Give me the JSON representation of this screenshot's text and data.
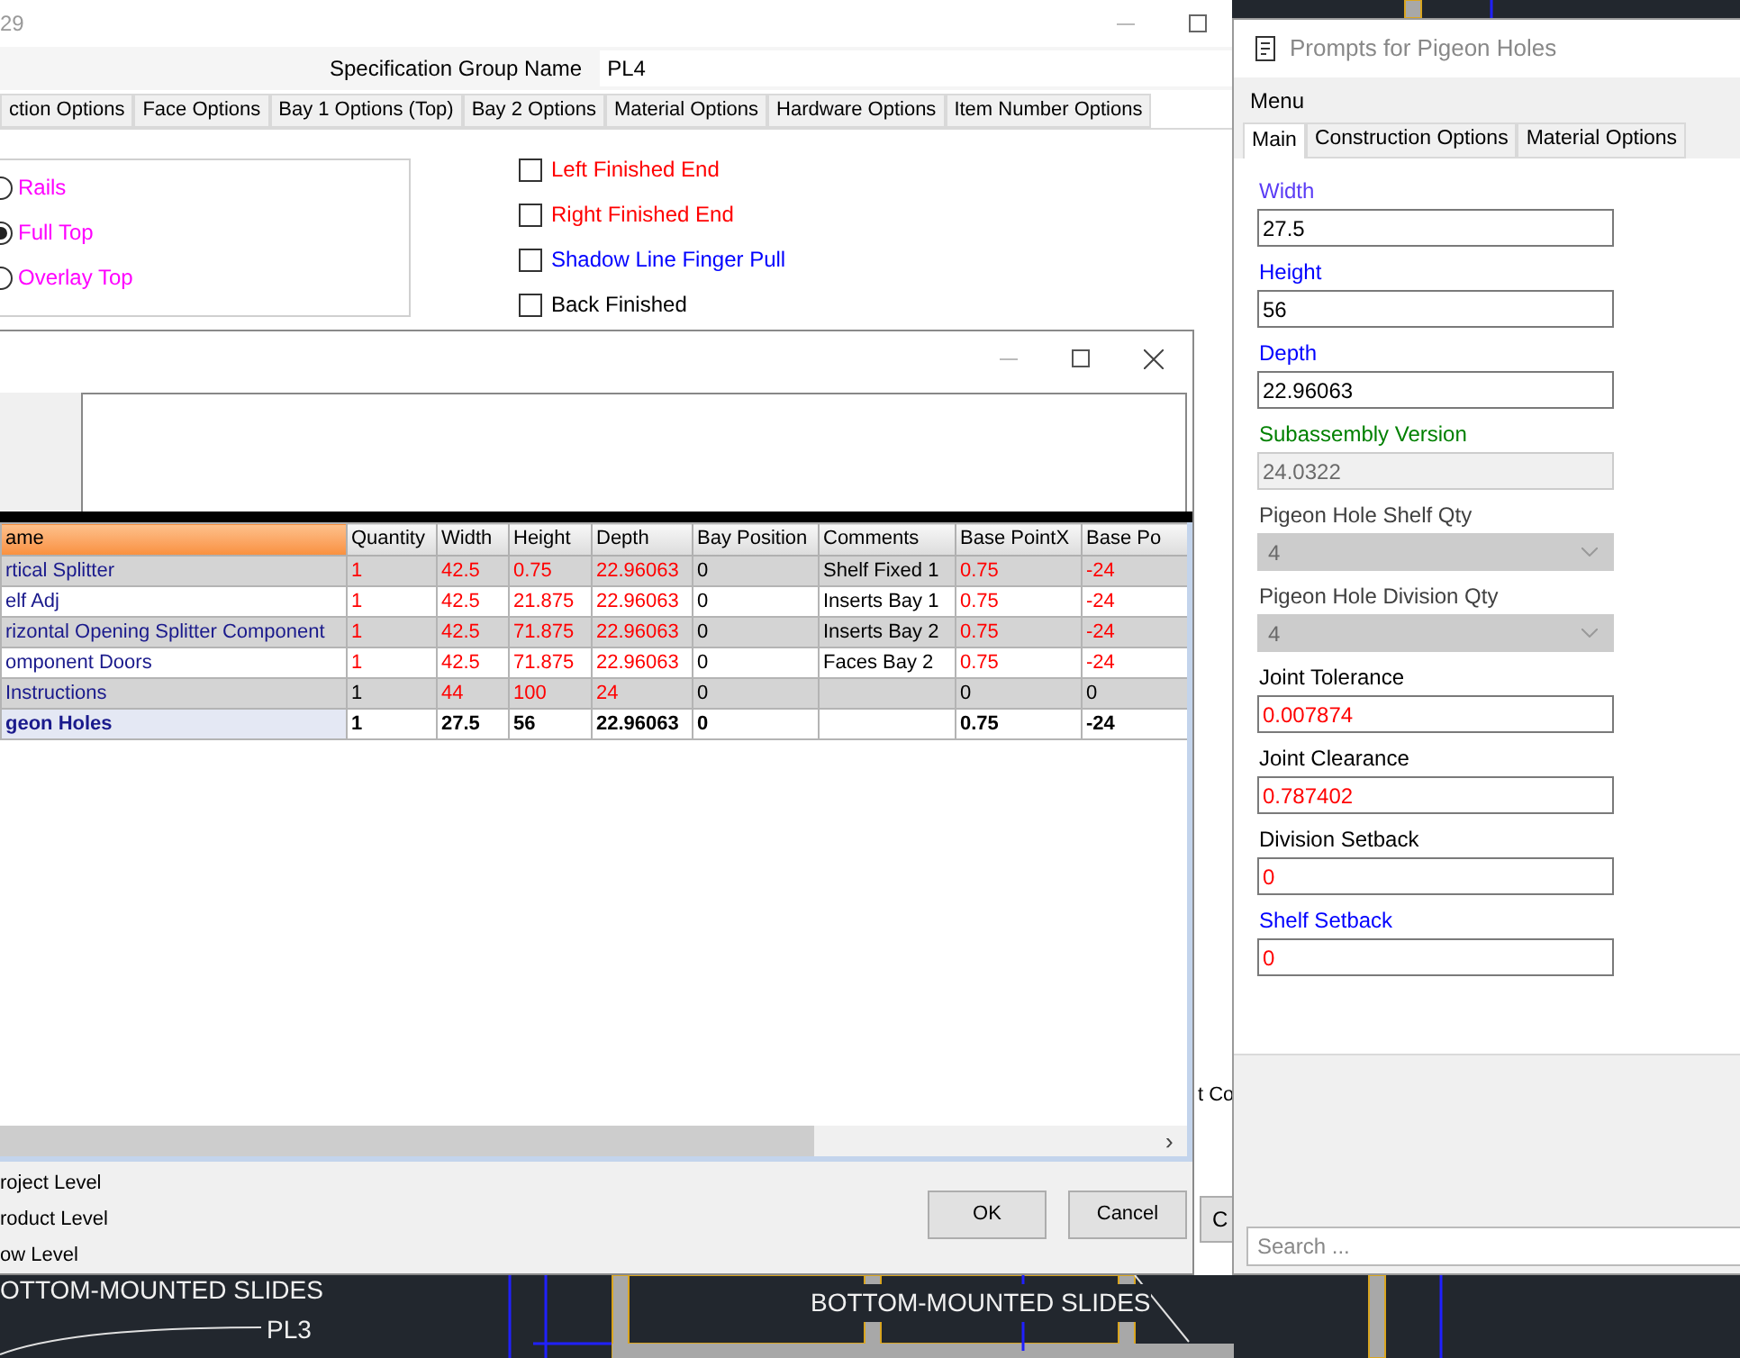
{
  "cad": {
    "labels": [
      "OTTOM-MOUNTED SLIDES",
      "PL3",
      "BOTTOM-MOUNTED SLIDES"
    ]
  },
  "main_window": {
    "title": "29",
    "spec_label": "Specification Group Name",
    "spec_value": "PL4",
    "tabs": [
      {
        "label": "ction Options",
        "selected": false
      },
      {
        "label": "Face Options",
        "selected": false
      },
      {
        "label": "Bay 1 Options (Top)",
        "selected": false
      },
      {
        "label": "Bay 2 Options",
        "selected": false
      },
      {
        "label": "Material Options",
        "selected": false
      },
      {
        "label": "Hardware Options",
        "selected": false
      },
      {
        "label": "Item Number Options",
        "selected": false
      }
    ],
    "radios": [
      {
        "label": "Rails",
        "selected": false
      },
      {
        "label": "Full Top",
        "selected": true
      },
      {
        "label": "Overlay Top",
        "selected": false
      }
    ],
    "checkboxes": [
      {
        "label": "Left Finished End",
        "checked": false,
        "color": "#ff0000"
      },
      {
        "label": "Right Finished End",
        "checked": false,
        "color": "#ff0000"
      },
      {
        "label": "Shadow Line Finger Pull",
        "checked": false,
        "color": "#0000ff"
      },
      {
        "label": "Back Finished",
        "checked": false,
        "color": "#000000"
      }
    ],
    "side_text": "t Co",
    "side_button": "C"
  },
  "dialog": {
    "columns": [
      {
        "label": "ame",
        "selected": true
      },
      {
        "label": "Quantity",
        "selected": false
      },
      {
        "label": "Width",
        "selected": false
      },
      {
        "label": "Height",
        "selected": false
      },
      {
        "label": "Depth",
        "selected": false
      },
      {
        "label": "Bay Position",
        "selected": false
      },
      {
        "label": "Comments",
        "selected": false
      },
      {
        "label": "Base PointX",
        "selected": false
      },
      {
        "label": "Base Po",
        "selected": false
      }
    ],
    "rows": [
      {
        "selected": false,
        "cells": [
          {
            "text": "rtical Splitter",
            "flagged": false
          },
          {
            "text": "1",
            "flagged": true
          },
          {
            "text": "42.5",
            "flagged": true
          },
          {
            "text": "0.75",
            "flagged": true
          },
          {
            "text": "22.96063",
            "flagged": true
          },
          {
            "text": "0",
            "flagged": false
          },
          {
            "text": "Shelf Fixed 1",
            "flagged": false
          },
          {
            "text": "0.75",
            "flagged": true
          },
          {
            "text": "-24",
            "flagged": true
          }
        ]
      },
      {
        "selected": false,
        "cells": [
          {
            "text": "elf Adj",
            "flagged": false
          },
          {
            "text": "1",
            "flagged": true
          },
          {
            "text": "42.5",
            "flagged": true
          },
          {
            "text": "21.875",
            "flagged": true
          },
          {
            "text": "22.96063",
            "flagged": true
          },
          {
            "text": "0",
            "flagged": false
          },
          {
            "text": "Inserts Bay 1",
            "flagged": false
          },
          {
            "text": "0.75",
            "flagged": true
          },
          {
            "text": "-24",
            "flagged": true
          }
        ]
      },
      {
        "selected": false,
        "cells": [
          {
            "text": "rizontal Opening Splitter Component",
            "flagged": false
          },
          {
            "text": "1",
            "flagged": true
          },
          {
            "text": "42.5",
            "flagged": true
          },
          {
            "text": "71.875",
            "flagged": true
          },
          {
            "text": "22.96063",
            "flagged": true
          },
          {
            "text": "0",
            "flagged": false
          },
          {
            "text": "Inserts Bay 2",
            "flagged": false
          },
          {
            "text": "0.75",
            "flagged": true
          },
          {
            "text": "-24",
            "flagged": true
          }
        ]
      },
      {
        "selected": false,
        "cells": [
          {
            "text": "omponent Doors",
            "flagged": false
          },
          {
            "text": "1",
            "flagged": true
          },
          {
            "text": "42.5",
            "flagged": true
          },
          {
            "text": "71.875",
            "flagged": true
          },
          {
            "text": "22.96063",
            "flagged": true
          },
          {
            "text": "0",
            "flagged": false
          },
          {
            "text": "Faces Bay 2",
            "flagged": false
          },
          {
            "text": "0.75",
            "flagged": true
          },
          {
            "text": "-24",
            "flagged": true
          }
        ]
      },
      {
        "selected": false,
        "cells": [
          {
            "text": "Instructions",
            "flagged": false
          },
          {
            "text": "1",
            "flagged": false
          },
          {
            "text": "44",
            "flagged": true
          },
          {
            "text": "100",
            "flagged": true
          },
          {
            "text": "24",
            "flagged": true
          },
          {
            "text": "0",
            "flagged": false
          },
          {},
          {
            "text": "0",
            "flagged": false
          },
          {
            "text": "0",
            "flagged": false
          }
        ]
      },
      {
        "selected": true,
        "cells": [
          {
            "text": "geon Holes",
            "flagged": false
          },
          {
            "text": "1",
            "flagged": false
          },
          {
            "text": "27.5",
            "flagged": false
          },
          {
            "text": "56",
            "flagged": false
          },
          {
            "text": "22.96063",
            "flagged": false
          },
          {
            "text": "0",
            "flagged": false
          },
          {},
          {
            "text": "0.75",
            "flagged": false
          },
          {
            "text": "-24",
            "flagged": false
          }
        ]
      }
    ],
    "levels": [
      "roject Level",
      "roduct Level",
      "ow Level"
    ],
    "buttons": [
      "OK",
      "Cancel"
    ],
    "scroll_arrow": "›"
  },
  "prompts": {
    "title": "Prompts for Pigeon Holes",
    "menu": "Menu",
    "tabs": [
      {
        "label": "Main",
        "selected": true
      },
      {
        "label": "Construction Options",
        "selected": false
      },
      {
        "label": "Material Options",
        "selected": false
      }
    ],
    "fields": [
      {
        "label": "Width",
        "color": "#5a3cf5",
        "kind": "text",
        "value": "27.5",
        "disabled": false,
        "flagged": false
      },
      {
        "label": "Height",
        "color": "#0000ff",
        "kind": "text",
        "value": "56",
        "disabled": false,
        "flagged": false
      },
      {
        "label": "Depth",
        "color": "#0000ff",
        "kind": "text",
        "value": "22.96063",
        "disabled": false,
        "flagged": false
      },
      {
        "label": "Subassembly Version",
        "color": "#008000",
        "kind": "text",
        "value": "24.0322",
        "disabled": true,
        "flagged": false
      },
      {
        "label": "Pigeon Hole Shelf Qty",
        "color": "#404040",
        "kind": "select",
        "value": "4",
        "disabled": true,
        "flagged": false
      },
      {
        "label": "Pigeon Hole Division Qty",
        "color": "#404040",
        "kind": "select",
        "value": "4",
        "disabled": true,
        "flagged": false
      },
      {
        "label": "Joint Tolerance",
        "color": "#000000",
        "kind": "text",
        "value": "0.007874",
        "disabled": false,
        "flagged": true
      },
      {
        "label": "Joint Clearance",
        "color": "#000000",
        "kind": "text",
        "value": "0.787402",
        "disabled": false,
        "flagged": true
      },
      {
        "label": "Division Setback",
        "color": "#000000",
        "kind": "text",
        "value": "0",
        "disabled": false,
        "flagged": true
      },
      {
        "label": "Shelf Setback",
        "color": "#0000ff",
        "kind": "text",
        "value": "0",
        "disabled": false,
        "flagged": true
      }
    ],
    "search": {
      "placeholder": "Search ..."
    }
  }
}
